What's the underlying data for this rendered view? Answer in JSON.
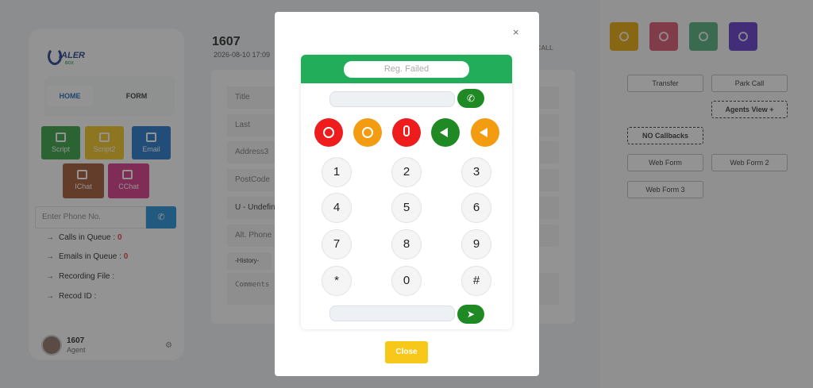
{
  "app": {
    "logo_text": "IALER",
    "logo_sub": "BOX",
    "tabs": {
      "home": "HOME",
      "form": "FORM"
    },
    "tiles": [
      {
        "label": "Script",
        "color": "#2e9e3e"
      },
      {
        "label": "Script2",
        "color": "#f5c518"
      },
      {
        "label": "Email",
        "color": "#1a73c8"
      },
      {
        "label": "IChat",
        "color": "#a0522d"
      },
      {
        "label": "CChat",
        "color": "#d63384"
      }
    ],
    "phone_placeholder": "Enter Phone No.",
    "info": {
      "calls_label": "Calls in Queue : ",
      "calls_value": "0",
      "emails_label": "Emails in Queue : ",
      "emails_value": "0",
      "recording_label": "Recording File :",
      "record_id_label": "Recod ID :"
    },
    "agent": {
      "name": "1607",
      "role": "Agent"
    },
    "main": {
      "title": "1607",
      "date": "2026-08-10 17:09",
      "call_label": "E CALL",
      "fields": [
        "Title",
        "Last",
        "Address3",
        "PostCode",
        "U - Undefine",
        "Alt. Phone"
      ],
      "history": "-History-",
      "comments_placeholder": "Comments"
    },
    "right": {
      "controls": [
        {
          "name": "pause",
          "color": "#e6a700"
        },
        {
          "name": "hangup",
          "color": "#d9506a"
        },
        {
          "name": "record",
          "color": "#4caf7a"
        },
        {
          "name": "mobile",
          "color": "#5a32c8"
        }
      ],
      "transfer": "Transfer",
      "park_call": "Park Call",
      "agents_view": "Agents View +",
      "no_callbacks": "NO Callbacks",
      "web_form": "Web Form",
      "web_form_2": "Web Form 2",
      "web_form_3": "Web Form 3"
    }
  },
  "modal": {
    "close_x": "×",
    "status": "Reg. Failed",
    "controls": [
      {
        "name": "cancel",
        "color": "#ee1c1c"
      },
      {
        "name": "hold",
        "color": "#f39c12"
      },
      {
        "name": "mic",
        "color": "#ee1c1c"
      },
      {
        "name": "volume-up",
        "color": "#1f8a24"
      },
      {
        "name": "volume-down",
        "color": "#f39c12"
      }
    ],
    "keys": [
      "1",
      "2",
      "3",
      "4",
      "5",
      "6",
      "7",
      "8",
      "9",
      "*",
      "0",
      "#"
    ],
    "close_label": "Close"
  }
}
